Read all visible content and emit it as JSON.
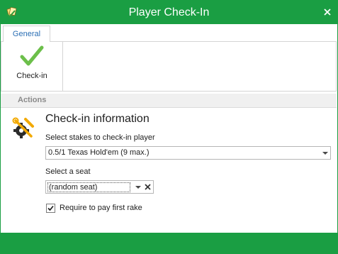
{
  "window": {
    "title": "Player Check-In",
    "accent_color": "#1a9e43",
    "app_icon": "pokerchip-cards-icon",
    "close_icon": "close-icon"
  },
  "ribbon": {
    "tabs": [
      {
        "label": "General",
        "selected": true
      }
    ],
    "checkin_button": {
      "label": "Check-in",
      "icon": "green-checkmark-icon"
    },
    "group_label": "Actions"
  },
  "form": {
    "icon": "tools-gear-icon",
    "title": "Check-in information",
    "stakes": {
      "label": "Select stakes to check-in player",
      "value": "0.5/1 Texas Hold'em (9 max.)"
    },
    "seat": {
      "label": "Select a seat",
      "value": "(random seat)"
    },
    "rake": {
      "label": "Require to pay first rake",
      "checked": true
    }
  }
}
